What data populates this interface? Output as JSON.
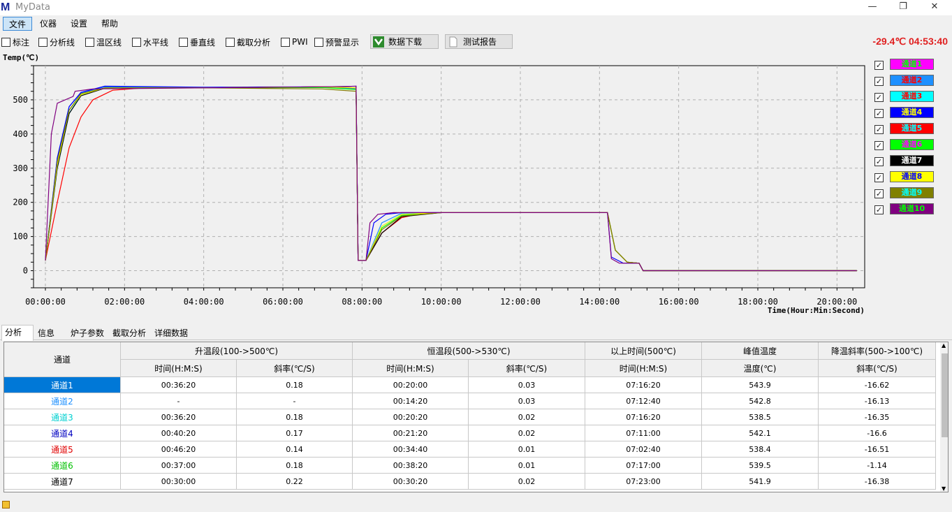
{
  "app": {
    "logo": "M",
    "title": "MyData"
  },
  "window": {
    "minimize_icon": "minimize-icon",
    "restore_icon": "restore-icon",
    "close_icon": "close-icon"
  },
  "menu": [
    "文件",
    "仪器",
    "设置",
    "帮助"
  ],
  "toolbar": {
    "checks": [
      "标注",
      "分析线",
      "温区线",
      "水平线",
      "垂直线",
      "截取分析",
      "PWI",
      "预警显示"
    ],
    "download_label": "数据下载",
    "report_label": "测试报告",
    "status_reading": "-29.4℃ 04:53:40"
  },
  "chart_data": {
    "type": "line",
    "ylabel": "Temp(℃)",
    "xlabel": "Time(Hour:Min:Second)",
    "ylim": [
      -50,
      600
    ],
    "xlim_hours": [
      -0.3,
      20.7
    ],
    "y_ticks": [
      "0",
      "100",
      "200",
      "300",
      "400",
      "500"
    ],
    "x_ticks": [
      "00:00:00",
      "02:00:00",
      "04:00:00",
      "06:00:00",
      "08:00:00",
      "10:00:00",
      "12:00:00",
      "14:00:00",
      "16:00:00",
      "18:00:00",
      "20:00:00"
    ],
    "grid": true,
    "legend_position": "right",
    "series": [
      {
        "name": "通道1",
        "color": "#ff00ff",
        "text_color": "#00ff00",
        "points": [
          [
            0,
            30
          ],
          [
            0.3,
            320
          ],
          [
            0.6,
            470
          ],
          [
            0.9,
            515
          ],
          [
            1.5,
            535
          ],
          [
            4,
            535
          ],
          [
            7,
            538
          ],
          [
            7.85,
            535
          ],
          [
            7.9,
            30
          ],
          [
            8.1,
            30
          ],
          [
            8.5,
            130
          ],
          [
            9,
            165
          ],
          [
            10,
            170
          ],
          [
            14,
            170
          ],
          [
            14.2,
            170
          ],
          [
            14.4,
            60
          ],
          [
            14.7,
            25
          ],
          [
            15,
            22
          ],
          [
            15.1,
            0
          ],
          [
            20.5,
            0
          ]
        ]
      },
      {
        "name": "通道2",
        "color": "#1e90ff",
        "text_color": "#ff0000",
        "points": [
          [
            0,
            30
          ],
          [
            0.3,
            330
          ],
          [
            0.6,
            480
          ],
          [
            0.9,
            520
          ],
          [
            1.5,
            538
          ],
          [
            4,
            535
          ],
          [
            7,
            538
          ],
          [
            7.85,
            532
          ],
          [
            7.9,
            30
          ],
          [
            8.1,
            30
          ],
          [
            8.5,
            140
          ],
          [
            9,
            168
          ],
          [
            10,
            170
          ],
          [
            14,
            170
          ],
          [
            14.2,
            170
          ],
          [
            14.4,
            60
          ],
          [
            14.7,
            25
          ],
          [
            15,
            22
          ],
          [
            15.1,
            0
          ],
          [
            20.5,
            0
          ]
        ]
      },
      {
        "name": "通道3",
        "color": "#00ffff",
        "text_color": "#ff0000",
        "points": [
          [
            0,
            30
          ],
          [
            0.3,
            300
          ],
          [
            0.6,
            460
          ],
          [
            0.9,
            515
          ],
          [
            1.5,
            535
          ],
          [
            4,
            535
          ],
          [
            7,
            538
          ],
          [
            7.85,
            535
          ],
          [
            7.9,
            30
          ],
          [
            8.1,
            30
          ],
          [
            8.5,
            130
          ],
          [
            9,
            165
          ],
          [
            10,
            170
          ],
          [
            14,
            170
          ],
          [
            14.2,
            170
          ],
          [
            14.4,
            60
          ],
          [
            14.7,
            25
          ],
          [
            15,
            22
          ],
          [
            15.1,
            0
          ],
          [
            20.5,
            0
          ]
        ]
      },
      {
        "name": "通道4",
        "color": "#0000ff",
        "text_color": "#ffff00",
        "points": [
          [
            0,
            30
          ],
          [
            0.3,
            330
          ],
          [
            0.6,
            480
          ],
          [
            0.9,
            522
          ],
          [
            1.5,
            540
          ],
          [
            4,
            537
          ],
          [
            7,
            538
          ],
          [
            7.85,
            540
          ],
          [
            7.9,
            30
          ],
          [
            8.1,
            30
          ],
          [
            8.3,
            140
          ],
          [
            8.6,
            165
          ],
          [
            9,
            170
          ],
          [
            14,
            170
          ],
          [
            14.2,
            170
          ],
          [
            14.3,
            40
          ],
          [
            14.6,
            22
          ],
          [
            15,
            22
          ],
          [
            15.1,
            0
          ],
          [
            20.5,
            0
          ]
        ]
      },
      {
        "name": "通道5",
        "color": "#ff0000",
        "text_color": "#00ffff",
        "points": [
          [
            0,
            30
          ],
          [
            0.3,
            200
          ],
          [
            0.6,
            360
          ],
          [
            0.9,
            450
          ],
          [
            1.2,
            500
          ],
          [
            1.7,
            528
          ],
          [
            2.5,
            535
          ],
          [
            4,
            535
          ],
          [
            7,
            538
          ],
          [
            7.85,
            535
          ],
          [
            7.9,
            30
          ],
          [
            8.1,
            30
          ],
          [
            8.5,
            110
          ],
          [
            9,
            155
          ],
          [
            9.5,
            168
          ],
          [
            10,
            170
          ],
          [
            14,
            170
          ],
          [
            14.2,
            170
          ],
          [
            14.4,
            60
          ],
          [
            14.7,
            25
          ],
          [
            15,
            22
          ],
          [
            15.1,
            0
          ],
          [
            20.5,
            0
          ]
        ]
      },
      {
        "name": "通道6",
        "color": "#00ff00",
        "text_color": "#ff00ff",
        "points": [
          [
            0,
            30
          ],
          [
            0.3,
            310
          ],
          [
            0.6,
            470
          ],
          [
            0.9,
            515
          ],
          [
            1.5,
            535
          ],
          [
            4,
            535
          ],
          [
            7,
            536
          ],
          [
            7.85,
            530
          ],
          [
            7.9,
            30
          ],
          [
            8.1,
            30
          ],
          [
            8.5,
            125
          ],
          [
            9,
            162
          ],
          [
            10,
            170
          ],
          [
            14,
            170
          ],
          [
            14.2,
            170
          ],
          [
            14.4,
            60
          ],
          [
            14.7,
            25
          ],
          [
            15,
            22
          ],
          [
            15.1,
            0
          ],
          [
            20.5,
            0
          ]
        ]
      },
      {
        "name": "通道7",
        "color": "#000000",
        "text_color": "#ffffff",
        "points": [
          [
            0,
            30
          ],
          [
            0.3,
            300
          ],
          [
            0.6,
            460
          ],
          [
            0.9,
            512
          ],
          [
            1.5,
            534
          ],
          [
            4,
            535
          ],
          [
            7,
            538
          ],
          [
            7.85,
            535
          ],
          [
            7.9,
            30
          ],
          [
            8.1,
            30
          ],
          [
            8.5,
            110
          ],
          [
            9,
            158
          ],
          [
            10,
            170
          ],
          [
            14,
            170
          ],
          [
            14.2,
            170
          ],
          [
            14.4,
            60
          ],
          [
            14.7,
            25
          ],
          [
            15,
            22
          ],
          [
            15.1,
            0
          ],
          [
            20.5,
            0
          ]
        ]
      },
      {
        "name": "通道8",
        "color": "#ffff00",
        "text_color": "#0000ff",
        "points": [
          [
            0,
            30
          ],
          [
            0.3,
            310
          ],
          [
            0.6,
            470
          ],
          [
            0.9,
            515
          ],
          [
            1.5,
            535
          ],
          [
            4,
            535
          ],
          [
            7,
            538
          ],
          [
            7.85,
            535
          ],
          [
            7.9,
            30
          ],
          [
            8.1,
            30
          ],
          [
            8.5,
            130
          ],
          [
            9,
            165
          ],
          [
            10,
            170
          ],
          [
            14,
            170
          ],
          [
            14.2,
            170
          ],
          [
            14.4,
            60
          ],
          [
            14.7,
            25
          ],
          [
            15,
            22
          ],
          [
            15.1,
            0
          ],
          [
            20.5,
            0
          ]
        ]
      },
      {
        "name": "通道9",
        "color": "#808000",
        "text_color": "#00ffff",
        "points": [
          [
            0,
            30
          ],
          [
            0.3,
            320
          ],
          [
            0.6,
            470
          ],
          [
            0.9,
            518
          ],
          [
            1.5,
            535
          ],
          [
            4,
            535
          ],
          [
            7,
            532
          ],
          [
            7.85,
            525
          ],
          [
            7.9,
            30
          ],
          [
            8.1,
            30
          ],
          [
            8.5,
            120
          ],
          [
            9,
            160
          ],
          [
            10,
            170
          ],
          [
            14,
            170
          ],
          [
            14.2,
            170
          ],
          [
            14.4,
            60
          ],
          [
            14.7,
            25
          ],
          [
            15,
            22
          ],
          [
            15.1,
            0
          ],
          [
            20.5,
            0
          ]
        ]
      },
      {
        "name": "通道10",
        "color": "#800080",
        "text_color": "#00ff00",
        "points": [
          [
            0,
            30
          ],
          [
            0.15,
            400
          ],
          [
            0.3,
            490
          ],
          [
            0.7,
            510
          ],
          [
            0.75,
            525
          ],
          [
            1.2,
            532
          ],
          [
            4,
            535
          ],
          [
            7,
            538
          ],
          [
            7.85,
            540
          ],
          [
            7.9,
            30
          ],
          [
            8.1,
            30
          ],
          [
            8.2,
            140
          ],
          [
            8.4,
            165
          ],
          [
            8.8,
            170
          ],
          [
            14,
            170
          ],
          [
            14.2,
            170
          ],
          [
            14.3,
            35
          ],
          [
            14.5,
            22
          ],
          [
            15,
            22
          ],
          [
            15.1,
            0
          ],
          [
            20.5,
            0
          ]
        ]
      }
    ]
  },
  "tabs": [
    "分析",
    "信息",
    "炉子参数",
    "截取分析",
    "详细数据"
  ],
  "table": {
    "channel_header": "通道",
    "groups": [
      "升温段(100->500℃)",
      "恒温段(500->530℃)",
      "以上时间(500℃)",
      "峰值温度",
      "降温斜率(500->100℃)"
    ],
    "subheaders": [
      "时间(H:M:S)",
      "斜率(℃/S)",
      "时间(H:M:S)",
      "斜率(℃/S)",
      "时间(H:M:S)",
      "温度(℃)",
      "斜率(℃/S)"
    ],
    "rows": [
      {
        "channel": "通道1",
        "color": "#ffffff",
        "selected": true,
        "cells": [
          "00:36:20",
          "0.18",
          "00:20:00",
          "0.03",
          "07:16:20",
          "543.9",
          "-16.62"
        ]
      },
      {
        "channel": "通道2",
        "color": "#1e90ff",
        "selected": false,
        "cells": [
          "-",
          "-",
          "00:14:20",
          "0.03",
          "07:12:40",
          "542.8",
          "-16.13"
        ]
      },
      {
        "channel": "通道3",
        "color": "#00d0d0",
        "selected": false,
        "cells": [
          "00:36:20",
          "0.18",
          "00:20:20",
          "0.02",
          "07:16:20",
          "538.5",
          "-16.35"
        ]
      },
      {
        "channel": "通道4",
        "color": "#0000c0",
        "selected": false,
        "cells": [
          "00:40:20",
          "0.17",
          "00:21:20",
          "0.02",
          "07:11:00",
          "542.1",
          "-16.6"
        ]
      },
      {
        "channel": "通道5",
        "color": "#e00000",
        "selected": false,
        "cells": [
          "00:46:20",
          "0.14",
          "00:34:40",
          "0.01",
          "07:02:40",
          "538.4",
          "-16.51"
        ]
      },
      {
        "channel": "通道6",
        "color": "#00c000",
        "selected": false,
        "cells": [
          "00:37:00",
          "0.18",
          "00:38:20",
          "0.01",
          "07:17:00",
          "539.5",
          "-1.14"
        ]
      },
      {
        "channel": "通道7",
        "color": "#000000",
        "selected": false,
        "cells": [
          "00:30:00",
          "0.22",
          "00:30:20",
          "0.02",
          "07:23:00",
          "541.9",
          "-16.38"
        ]
      }
    ]
  }
}
